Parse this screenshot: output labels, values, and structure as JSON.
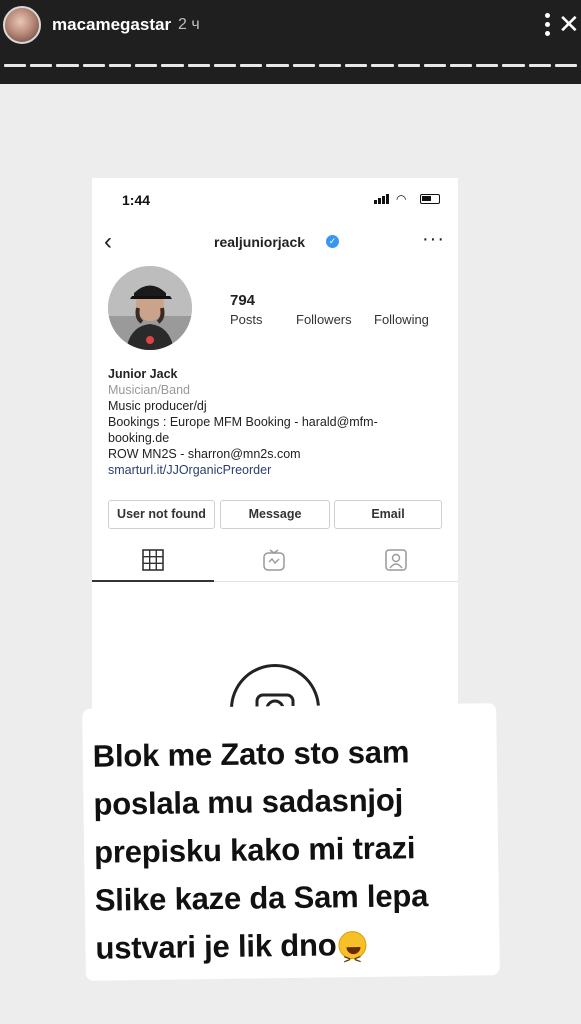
{
  "story": {
    "username": "macamegastar",
    "time_ago": "2 ч",
    "segments": 22
  },
  "profile_screenshot": {
    "status_time": "1:44",
    "handle": "realjuniorjack",
    "verified_mark": "✓",
    "back_icon": "chevron-left-icon",
    "more_icon": "more-horizontal-icon",
    "stats": {
      "posts_count": "794",
      "posts_label": "Posts",
      "followers_label": "Followers",
      "following_label": "Following"
    },
    "bio": {
      "name": "Junior Jack",
      "category": "Musician/Band",
      "line1": "Music producer/dj",
      "line2": "Bookings : Europe MFM Booking - harald@mfm-",
      "line3": "booking.de",
      "line4": "ROW MN2S - sharron@mn2s.com",
      "link": "smarturl.it/JJOrganicPreorder"
    },
    "buttons": {
      "user_not_found": "User not found",
      "message": "Message",
      "email": "Email"
    },
    "tabs": [
      "grid-icon",
      "igtv-icon",
      "tagged-icon"
    ]
  },
  "caption": {
    "lines": [
      "Blok me Zato sto sam",
      "poslala mu sadasnjoj",
      "prepisku kako mi trazi",
      "Slike kaze da Sam lepa",
      "ustvari je lik dno"
    ],
    "emoji": "laughing-face-emoji"
  },
  "colors": {
    "story_bar": "#1f1f1f",
    "verified": "#3897f0",
    "link": "#2a3f6f",
    "emoji": "#f7c02a"
  }
}
